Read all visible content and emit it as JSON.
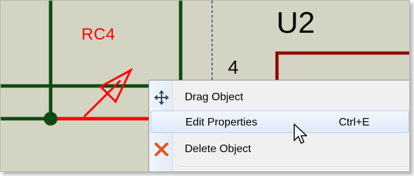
{
  "schematic": {
    "component_label": "RC4",
    "part_label": "U2",
    "pin_number": "4",
    "colors": {
      "background": "#d3d4c2",
      "wire": "#0b4a12",
      "highlight_wire": "#ff0000",
      "part_outline": "#8b0000"
    }
  },
  "context_menu": {
    "items": [
      {
        "label": "Drag Object",
        "icon": "move-icon"
      },
      {
        "label": "Edit Properties",
        "shortcut": "Ctrl+E",
        "highlighted": true
      },
      {
        "label": "Delete Object",
        "icon": "delete-x-icon"
      }
    ]
  }
}
